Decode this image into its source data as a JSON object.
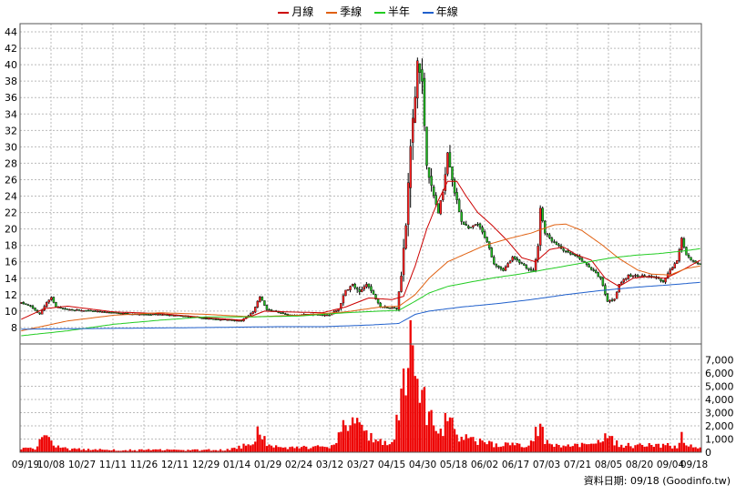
{
  "chart_data": {
    "type": "candlestick",
    "legend": [
      {
        "name": "月線",
        "color": "#cc0000"
      },
      {
        "name": "季線",
        "color": "#e06010"
      },
      {
        "name": "半年",
        "color": "#22cc22"
      },
      {
        "name": "年線",
        "color": "#2060cc"
      }
    ],
    "source_label": "資料日期: 09/18 (Goodinfo.tw)",
    "x_labels": [
      "09/19",
      "10/08",
      "10/27",
      "11/11",
      "11/26",
      "12/11",
      "12/29",
      "01/14",
      "01/29",
      "02/24",
      "03/12",
      "03/27",
      "04/15",
      "04/30",
      "05/18",
      "06/02",
      "06/17",
      "07/03",
      "07/21",
      "08/05",
      "08/20",
      "09/04",
      "09/18"
    ],
    "price_axis": {
      "ylim": [
        6,
        45
      ],
      "ticks": [
        8,
        10,
        12,
        14,
        16,
        18,
        20,
        22,
        24,
        26,
        28,
        30,
        32,
        34,
        36,
        38,
        40,
        42,
        44
      ],
      "grid": true
    },
    "volume_axis": {
      "ylim": [
        0,
        8200
      ],
      "ticks": [
        0,
        1000,
        2000,
        3000,
        4000,
        5000,
        6000,
        7000
      ],
      "tick_labels": [
        "0",
        "1,000",
        "2,000",
        "3,000",
        "4,000",
        "5,000",
        "6,000",
        "7,000"
      ],
      "grid": true
    },
    "price_keypoints": [
      [
        0,
        11.0
      ],
      [
        4,
        10.6
      ],
      [
        8,
        9.6
      ],
      [
        11,
        11.1
      ],
      [
        13,
        11.6
      ],
      [
        15,
        10.5
      ],
      [
        20,
        10.2
      ],
      [
        30,
        10.0
      ],
      [
        40,
        9.8
      ],
      [
        50,
        9.6
      ],
      [
        60,
        9.6
      ],
      [
        70,
        9.4
      ],
      [
        80,
        9.1
      ],
      [
        90,
        8.9
      ],
      [
        95,
        8.8
      ],
      [
        100,
        9.9
      ],
      [
        103,
        11.8
      ],
      [
        106,
        10.2
      ],
      [
        115,
        9.5
      ],
      [
        125,
        9.6
      ],
      [
        133,
        9.5
      ],
      [
        137,
        10.3
      ],
      [
        140,
        12.5
      ],
      [
        143,
        13.2
      ],
      [
        146,
        12.2
      ],
      [
        149,
        13.4
      ],
      [
        152,
        12.0
      ],
      [
        155,
        10.6
      ],
      [
        159,
        10.4
      ],
      [
        162,
        10.4
      ],
      [
        164,
        14.5
      ],
      [
        166,
        20.5
      ],
      [
        168,
        30.0
      ],
      [
        170,
        36.0
      ],
      [
        171,
        40.5
      ],
      [
        173,
        37.5
      ],
      [
        175,
        28.0
      ],
      [
        177,
        25.0
      ],
      [
        180,
        22.0
      ],
      [
        182,
        24.5
      ],
      [
        184,
        29.5
      ],
      [
        187,
        24.5
      ],
      [
        190,
        21.0
      ],
      [
        193,
        20.0
      ],
      [
        197,
        20.6
      ],
      [
        201,
        18.5
      ],
      [
        204,
        15.8
      ],
      [
        208,
        15.0
      ],
      [
        212,
        16.5
      ],
      [
        215,
        16.0
      ],
      [
        218,
        15.3
      ],
      [
        221,
        14.8
      ],
      [
        223,
        18.0
      ],
      [
        224,
        22.5
      ],
      [
        226,
        19.5
      ],
      [
        230,
        18.3
      ],
      [
        235,
        17.2
      ],
      [
        240,
        16.6
      ],
      [
        245,
        15.4
      ],
      [
        250,
        14.0
      ],
      [
        253,
        11.2
      ],
      [
        256,
        11.5
      ],
      [
        258,
        13.3
      ],
      [
        262,
        14.3
      ],
      [
        268,
        14.3
      ],
      [
        274,
        14.1
      ],
      [
        277,
        13.5
      ],
      [
        280,
        15.0
      ],
      [
        283,
        16.1
      ],
      [
        285,
        19.0
      ],
      [
        287,
        16.8
      ],
      [
        290,
        16.0
      ],
      [
        293,
        15.8
      ]
    ],
    "volume_keypoints": [
      [
        0,
        350
      ],
      [
        6,
        220
      ],
      [
        11,
        1750
      ],
      [
        14,
        500
      ],
      [
        20,
        240
      ],
      [
        30,
        200
      ],
      [
        40,
        180
      ],
      [
        50,
        160
      ],
      [
        60,
        180
      ],
      [
        70,
        150
      ],
      [
        80,
        170
      ],
      [
        90,
        200
      ],
      [
        100,
        700
      ],
      [
        103,
        1900
      ],
      [
        106,
        500
      ],
      [
        115,
        300
      ],
      [
        125,
        400
      ],
      [
        133,
        350
      ],
      [
        137,
        1200
      ],
      [
        140,
        2500
      ],
      [
        143,
        2200
      ],
      [
        146,
        1900
      ],
      [
        150,
        1400
      ],
      [
        155,
        800
      ],
      [
        160,
        700
      ],
      [
        164,
        3500
      ],
      [
        166,
        6000
      ],
      [
        168,
        7800
      ],
      [
        170,
        6500
      ],
      [
        171,
        5500
      ],
      [
        173,
        4500
      ],
      [
        176,
        2700
      ],
      [
        180,
        1200
      ],
      [
        184,
        2700
      ],
      [
        187,
        1600
      ],
      [
        190,
        1100
      ],
      [
        195,
        900
      ],
      [
        200,
        700
      ],
      [
        205,
        600
      ],
      [
        210,
        550
      ],
      [
        215,
        500
      ],
      [
        220,
        700
      ],
      [
        222,
        1500
      ],
      [
        224,
        2400
      ],
      [
        226,
        1000
      ],
      [
        230,
        600
      ],
      [
        240,
        500
      ],
      [
        250,
        700
      ],
      [
        253,
        1300
      ],
      [
        256,
        700
      ],
      [
        262,
        500
      ],
      [
        270,
        500
      ],
      [
        280,
        500
      ],
      [
        283,
        400
      ],
      [
        285,
        1400
      ],
      [
        287,
        700
      ],
      [
        290,
        400
      ],
      [
        293,
        300
      ]
    ],
    "moving_average_keypoints": {
      "月線": [
        [
          0,
          9.0
        ],
        [
          10,
          10.3
        ],
        [
          20,
          10.6
        ],
        [
          40,
          9.9
        ],
        [
          60,
          9.7
        ],
        [
          80,
          9.2
        ],
        [
          95,
          8.9
        ],
        [
          105,
          10.0
        ],
        [
          115,
          9.9
        ],
        [
          130,
          9.8
        ],
        [
          140,
          10.5
        ],
        [
          150,
          11.6
        ],
        [
          160,
          11.4
        ],
        [
          165,
          11.8
        ],
        [
          170,
          15.5
        ],
        [
          175,
          20.0
        ],
        [
          180,
          23.5
        ],
        [
          184,
          25.8
        ],
        [
          188,
          25.8
        ],
        [
          192,
          24.0
        ],
        [
          197,
          22.0
        ],
        [
          203,
          20.5
        ],
        [
          210,
          18.5
        ],
        [
          216,
          16.5
        ],
        [
          222,
          16.0
        ],
        [
          228,
          17.5
        ],
        [
          234,
          17.8
        ],
        [
          240,
          16.8
        ],
        [
          246,
          16.2
        ],
        [
          252,
          14.0
        ],
        [
          258,
          13.0
        ],
        [
          264,
          14.0
        ],
        [
          270,
          14.2
        ],
        [
          278,
          14.0
        ],
        [
          284,
          14.8
        ],
        [
          293,
          16.2
        ]
      ],
      "季線": [
        [
          0,
          7.6
        ],
        [
          20,
          8.8
        ],
        [
          40,
          9.5
        ],
        [
          60,
          9.8
        ],
        [
          80,
          9.6
        ],
        [
          100,
          9.3
        ],
        [
          120,
          9.5
        ],
        [
          140,
          9.9
        ],
        [
          155,
          10.5
        ],
        [
          163,
          10.6
        ],
        [
          170,
          12.0
        ],
        [
          176,
          14.0
        ],
        [
          184,
          16.0
        ],
        [
          192,
          17.0
        ],
        [
          200,
          18.0
        ],
        [
          210,
          18.8
        ],
        [
          220,
          19.5
        ],
        [
          230,
          20.5
        ],
        [
          235,
          20.6
        ],
        [
          242,
          19.8
        ],
        [
          250,
          18.2
        ],
        [
          258,
          16.4
        ],
        [
          266,
          15.0
        ],
        [
          272,
          14.5
        ],
        [
          280,
          14.4
        ],
        [
          287,
          15.2
        ],
        [
          293,
          15.5
        ]
      ],
      "半年": [
        [
          0,
          7.0
        ],
        [
          20,
          7.6
        ],
        [
          40,
          8.4
        ],
        [
          60,
          8.9
        ],
        [
          80,
          9.3
        ],
        [
          100,
          9.3
        ],
        [
          120,
          9.4
        ],
        [
          140,
          9.8
        ],
        [
          155,
          10.0
        ],
        [
          163,
          10.1
        ],
        [
          170,
          11.2
        ],
        [
          176,
          12.2
        ],
        [
          184,
          13.0
        ],
        [
          195,
          13.6
        ],
        [
          205,
          14.1
        ],
        [
          215,
          14.5
        ],
        [
          225,
          15.0
        ],
        [
          235,
          15.5
        ],
        [
          245,
          16.0
        ],
        [
          255,
          16.5
        ],
        [
          265,
          16.8
        ],
        [
          275,
          17.0
        ],
        [
          285,
          17.3
        ],
        [
          293,
          17.6
        ]
      ],
      "年線": [
        [
          0,
          7.8
        ],
        [
          40,
          7.9
        ],
        [
          80,
          8.0
        ],
        [
          110,
          8.1
        ],
        [
          130,
          8.1
        ],
        [
          150,
          8.3
        ],
        [
          163,
          8.5
        ],
        [
          170,
          9.6
        ],
        [
          176,
          10.0
        ],
        [
          190,
          10.5
        ],
        [
          205,
          10.9
        ],
        [
          220,
          11.4
        ],
        [
          235,
          12.0
        ],
        [
          250,
          12.5
        ],
        [
          265,
          12.9
        ],
        [
          280,
          13.2
        ],
        [
          293,
          13.5
        ]
      ]
    },
    "n_bars": 294
  }
}
